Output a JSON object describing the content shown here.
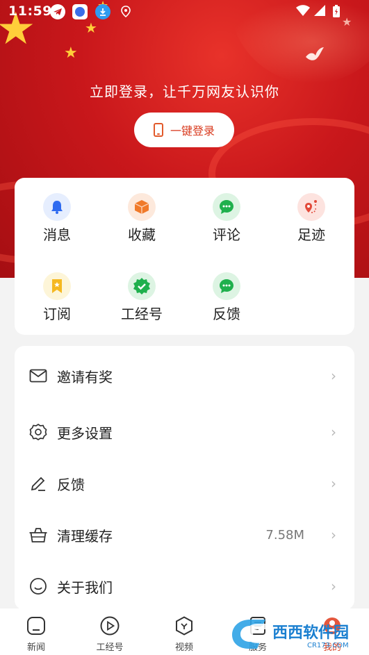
{
  "status": {
    "time": "11:59",
    "icons": [
      "telegram-icon",
      "messenger-icon",
      "download-icon",
      "location-icon"
    ],
    "right_icons": [
      "wifi-icon",
      "signal-icon",
      "battery-icon"
    ]
  },
  "hero": {
    "prompt": "立即登录，让千万网友认识你",
    "login_button": "一键登录"
  },
  "grid": {
    "items": [
      {
        "label": "消息",
        "icon": "bell-icon",
        "color": "#2f6bf0",
        "bg": "#e6eefe"
      },
      {
        "label": "收藏",
        "icon": "box-icon",
        "color": "#f07a2a",
        "bg": "#fde9dc"
      },
      {
        "label": "评论",
        "icon": "chat-icon",
        "color": "#1fb04d",
        "bg": "#ddf4e3"
      },
      {
        "label": "足迹",
        "icon": "map-pin-icon",
        "color": "#e24a3a",
        "bg": "#fde3df"
      },
      {
        "label": "订阅",
        "icon": "bookmark-icon",
        "color": "#f5b820",
        "bg": "#fdf5d8"
      },
      {
        "label": "工经号",
        "icon": "verified-icon",
        "color": "#1fb04d",
        "bg": "#ddf4e3"
      },
      {
        "label": "反馈",
        "icon": "chat-icon",
        "color": "#1fb04d",
        "bg": "#ddf4e3"
      }
    ]
  },
  "menu": {
    "items": [
      {
        "label": "邀请有奖",
        "icon": "mail-icon",
        "value": ""
      },
      {
        "label": "更多设置",
        "icon": "settings-icon",
        "value": ""
      },
      {
        "label": "反馈",
        "icon": "edit-icon",
        "value": ""
      },
      {
        "label": "清理缓存",
        "icon": "basket-icon",
        "value": "7.58M"
      },
      {
        "label": "关于我们",
        "icon": "smile-icon",
        "value": ""
      }
    ]
  },
  "tabs": [
    {
      "label": "新闻",
      "icon": "home-icon"
    },
    {
      "label": "工经号",
      "icon": "play-icon"
    },
    {
      "label": "视频",
      "icon": "hexagon-icon"
    },
    {
      "label": "服务",
      "icon": "document-icon"
    },
    {
      "label": "我的",
      "icon": "avatar-icon",
      "active": true
    }
  ],
  "watermark": "西西软件园",
  "colors": {
    "accent": "#d93b1f",
    "hero": "#c9171b"
  }
}
